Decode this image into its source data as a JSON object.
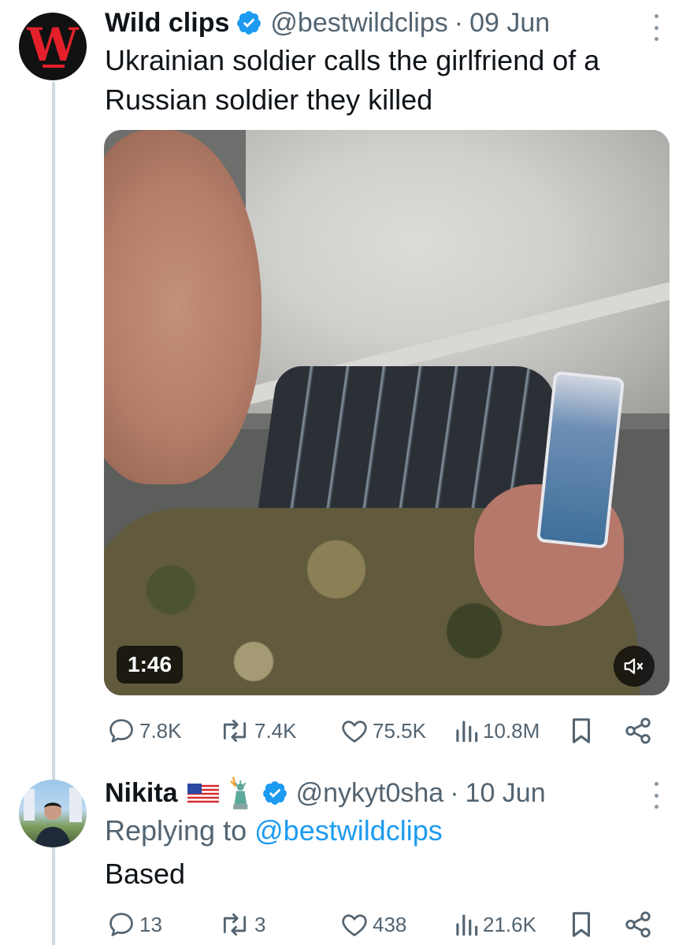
{
  "tweet": {
    "author_name": "Wild clips",
    "author_handle": "@bestwildclips",
    "separator": "·",
    "date": "09 Jun",
    "text_line1": "Ukrainian soldier calls the girlfriend of a",
    "text_line2": "Russian soldier they killed",
    "avatar_letter": "W",
    "video_duration": "1:46",
    "stats": {
      "replies": "7.8K",
      "reposts": "7.4K",
      "likes": "75.5K",
      "views": "10.8M"
    }
  },
  "reply": {
    "author_name": "Nikita",
    "author_emojis": [
      "us-flag-icon",
      "statue-of-liberty-icon"
    ],
    "author_handle": "@nykyt0sha",
    "separator": "·",
    "date": "10 Jun",
    "replying_prefix": "Replying to",
    "replying_to": "@bestwildclips",
    "text": "Based",
    "stats": {
      "replies": "13",
      "reposts": "3",
      "likes": "438",
      "views": "21.6K"
    }
  },
  "colors": {
    "accent": "#1d9bf0",
    "muted_text": "#536471",
    "logo_red": "#e3202a"
  }
}
